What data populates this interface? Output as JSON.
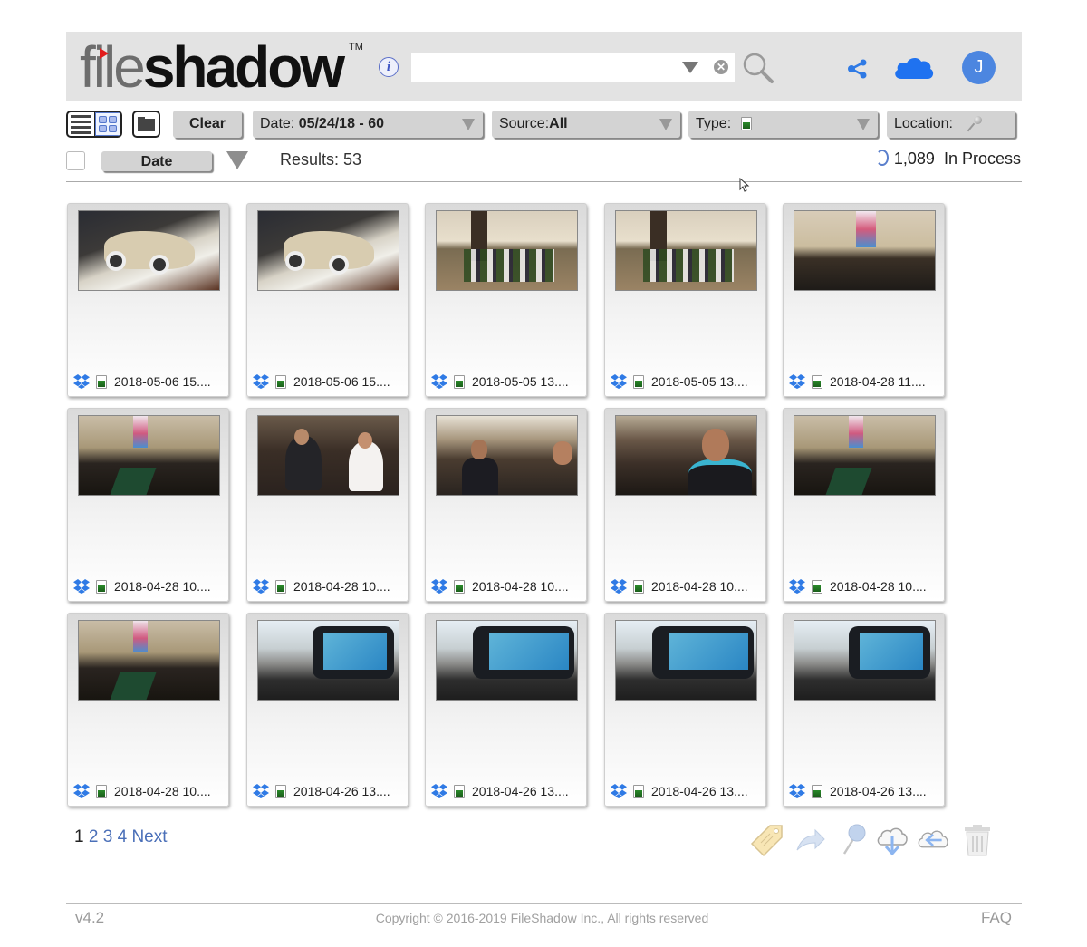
{
  "header": {
    "logo_light": "file",
    "logo_bold": "shadow",
    "trademark": "TM",
    "info_label": "i",
    "search": {
      "value": "",
      "placeholder": ""
    },
    "clear_search_symbol": "✕",
    "avatar_initial": "J",
    "accent_color": "#2f7ae5"
  },
  "toolbar": {
    "clear_label": "Clear",
    "date_filter": {
      "label": "Date: ",
      "value": "05/24/18 - 60"
    },
    "source_filter": {
      "label": "Source:",
      "value": "All"
    },
    "type_filter": {
      "label": "Type: ",
      "value_icon": "image-file-icon"
    },
    "location_filter": {
      "label": "Location:",
      "value_icon": "pin-icon"
    }
  },
  "subbar": {
    "sort_label": "Date",
    "results_label": "Results: 53",
    "in_process_count": "1,089",
    "in_process_label": "In Process"
  },
  "files": [
    {
      "name": "2018-05-06 15....",
      "source_icon": "dropbox-icon",
      "type_icon": "image-file-icon",
      "scene": "car"
    },
    {
      "name": "2018-05-06 15....",
      "source_icon": "dropbox-icon",
      "type_icon": "image-file-icon",
      "scene": "car"
    },
    {
      "name": "2018-05-05 13....",
      "source_icon": "dropbox-icon",
      "type_icon": "image-file-icon",
      "scene": "baseball"
    },
    {
      "name": "2018-05-05 13....",
      "source_icon": "dropbox-icon",
      "type_icon": "image-file-icon",
      "scene": "baseball"
    },
    {
      "name": "2018-04-28 11....",
      "source_icon": "dropbox-icon",
      "type_icon": "image-file-icon",
      "scene": "church"
    },
    {
      "name": "2018-04-28 10....",
      "source_icon": "dropbox-icon",
      "type_icon": "image-file-icon",
      "scene": "church-dark"
    },
    {
      "name": "2018-04-28 10....",
      "source_icon": "dropbox-icon",
      "type_icon": "image-file-icon",
      "scene": "pews"
    },
    {
      "name": "2018-04-28 10....",
      "source_icon": "dropbox-icon",
      "type_icon": "image-file-icon",
      "scene": "teen"
    },
    {
      "name": "2018-04-28 10....",
      "source_icon": "dropbox-icon",
      "type_icon": "image-file-icon",
      "scene": "man"
    },
    {
      "name": "2018-04-28 10....",
      "source_icon": "dropbox-icon",
      "type_icon": "image-file-icon",
      "scene": "church-dark"
    },
    {
      "name": "2018-04-28 10....",
      "source_icon": "dropbox-icon",
      "type_icon": "image-file-icon",
      "scene": "church-dark"
    },
    {
      "name": "2018-04-26 13....",
      "source_icon": "dropbox-icon",
      "type_icon": "image-file-icon",
      "scene": "dashcam"
    },
    {
      "name": "2018-04-26 13....",
      "source_icon": "dropbox-icon",
      "type_icon": "image-file-icon",
      "scene": "dashcam2"
    },
    {
      "name": "2018-04-26 13....",
      "source_icon": "dropbox-icon",
      "type_icon": "image-file-icon",
      "scene": "dashcam2"
    },
    {
      "name": "2018-04-26 13....",
      "source_icon": "dropbox-icon",
      "type_icon": "image-file-icon",
      "scene": "dashcam"
    }
  ],
  "pagination": {
    "current": "1",
    "pages": [
      "2",
      "3",
      "4"
    ],
    "next_label": "Next"
  },
  "actions": [
    "tag-icon",
    "share-arrow-icon",
    "location-pin-icon",
    "cloud-download-icon",
    "cloud-restore-icon",
    "trash-icon"
  ],
  "footer": {
    "version": "v4.2",
    "copyright": "Copyright © 2016-2019 FileShadow Inc., All rights reserved",
    "faq_label": "FAQ"
  }
}
